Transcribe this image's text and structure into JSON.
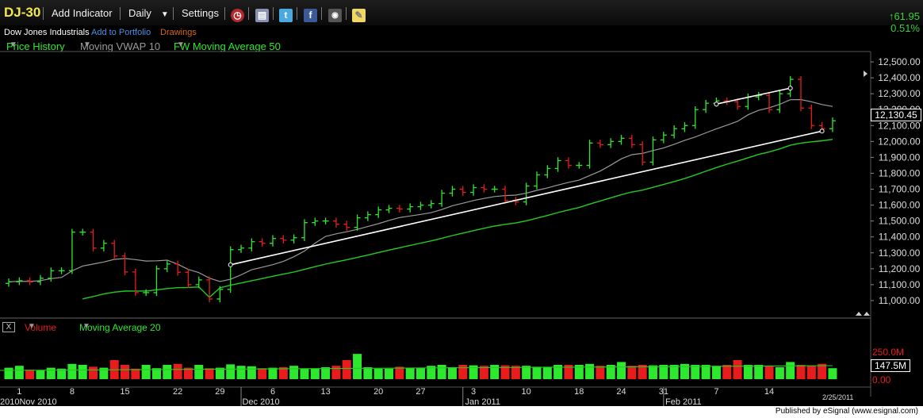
{
  "toolbar": {
    "ticker": "DJ-30",
    "add_indicator": "Add Indicator",
    "interval": "Daily",
    "settings": "Settings",
    "icons": [
      "alarm-clock-icon",
      "documents-icon",
      "twitter-icon",
      "facebook-icon",
      "camera-icon",
      "note-icon"
    ]
  },
  "info": {
    "name": "Dow Jones Industrials",
    "add_to_portfolio": "Add to Portfolio",
    "drawings": "Drawings",
    "change": "61.95",
    "change_pct": "0.51%"
  },
  "legend": {
    "price_history": "Price History",
    "vwap": "Moving VWAP 10",
    "ma50": "FW Moving Average 50",
    "volume": "Volume",
    "ma20": "Moving Average 20",
    "close_button": "X"
  },
  "colors": {
    "up": "#2ee82e",
    "down": "#e81c1c",
    "ma50": "#22cc22",
    "vwap": "#9a9a9a",
    "ticker": "#f4e84a",
    "link": "#4a90e2",
    "drawings": "#d2691e"
  },
  "footer": {
    "published": "Published by eSignal (www.esignal.com)",
    "date_stamp": "2/25/2011"
  },
  "chart_data": {
    "type": "line",
    "title": "DJ-30",
    "last_price": "12,130.45",
    "last_volume": "147.5M",
    "y_ticks": [
      "12,500.00",
      "12,400.00",
      "12,300.00",
      "12,200.00",
      "12,100.00",
      "12,000.00",
      "11,900.00",
      "11,800.00",
      "11,700.00",
      "11,600.00",
      "11,500.00",
      "11,400.00",
      "11,300.00",
      "11,200.00",
      "11,100.00",
      "11,000.00"
    ],
    "y_values": [
      12500,
      12400,
      12300,
      12200,
      12100,
      12000,
      11900,
      11800,
      11700,
      11600,
      11500,
      11400,
      11300,
      11200,
      11100,
      11000
    ],
    "ylim": [
      10925,
      12550
    ],
    "volume_ticks": [
      "250.0M",
      "0.00"
    ],
    "x_day_labels": [
      "1",
      "8",
      "15",
      "22",
      "29",
      "6",
      "13",
      "20",
      "27",
      "3",
      "10",
      "18",
      "24",
      "31",
      "7",
      "14"
    ],
    "x_day_index": [
      1,
      6,
      11,
      16,
      20,
      25,
      30,
      35,
      39,
      44,
      49,
      54,
      58,
      62,
      67,
      72
    ],
    "x_month_labels": [
      "2010Nov 2010",
      "Dec 2010",
      "Jan 2011",
      "Feb 2011"
    ],
    "x_month_index": [
      0,
      22,
      43,
      62
    ],
    "closes": [
      11118,
      11125,
      11118,
      11140,
      11187,
      11188,
      11430,
      11430,
      11330,
      11360,
      11280,
      11180,
      11050,
      11050,
      11200,
      11230,
      11178,
      11100,
      11130,
      11010,
      11070,
      11320,
      11330,
      11370,
      11360,
      11390,
      11380,
      11395,
      11490,
      11500,
      11500,
      11480,
      11460,
      11520,
      11540,
      11570,
      11580,
      11575,
      11590,
      11600,
      11610,
      11675,
      11700,
      11680,
      11710,
      11700,
      11700,
      11630,
      11620,
      11720,
      11790,
      11830,
      11880,
      11850,
      11850,
      11990,
      11980,
      12000,
      12020,
      11980,
      11870,
      12010,
      12040,
      12080,
      12100,
      12200,
      12240,
      12255,
      12250,
      12220,
      12280,
      12290,
      12200,
      12300,
      12390,
      12210,
      12100,
      12080,
      12130
    ],
    "high_low_range_typical": 30,
    "volume_pct": [
      24,
      28,
      20,
      19,
      24,
      22,
      32,
      30,
      26,
      24,
      40,
      30,
      22,
      30,
      23,
      30,
      32,
      24,
      30,
      23,
      24,
      31,
      28,
      27,
      23,
      24,
      25,
      28,
      22,
      22,
      25,
      28,
      40,
      53,
      25,
      22,
      22,
      26,
      24,
      24,
      28,
      30,
      25,
      30,
      29,
      28,
      30,
      29,
      28,
      28,
      26,
      26,
      30,
      30,
      30,
      32,
      28,
      30,
      36,
      28,
      30,
      29,
      30,
      30,
      32,
      30,
      30,
      28,
      30,
      40,
      30,
      30,
      28,
      25,
      36,
      30,
      29,
      32,
      23
    ],
    "ma20_volume": 25,
    "trendlines": [
      {
        "from_index": 21,
        "from_value": 11225,
        "to_index": 77,
        "to_value": 12065
      },
      {
        "from_index": 67,
        "from_value": 12235,
        "to_index": 74,
        "to_value": 12335
      }
    ]
  }
}
